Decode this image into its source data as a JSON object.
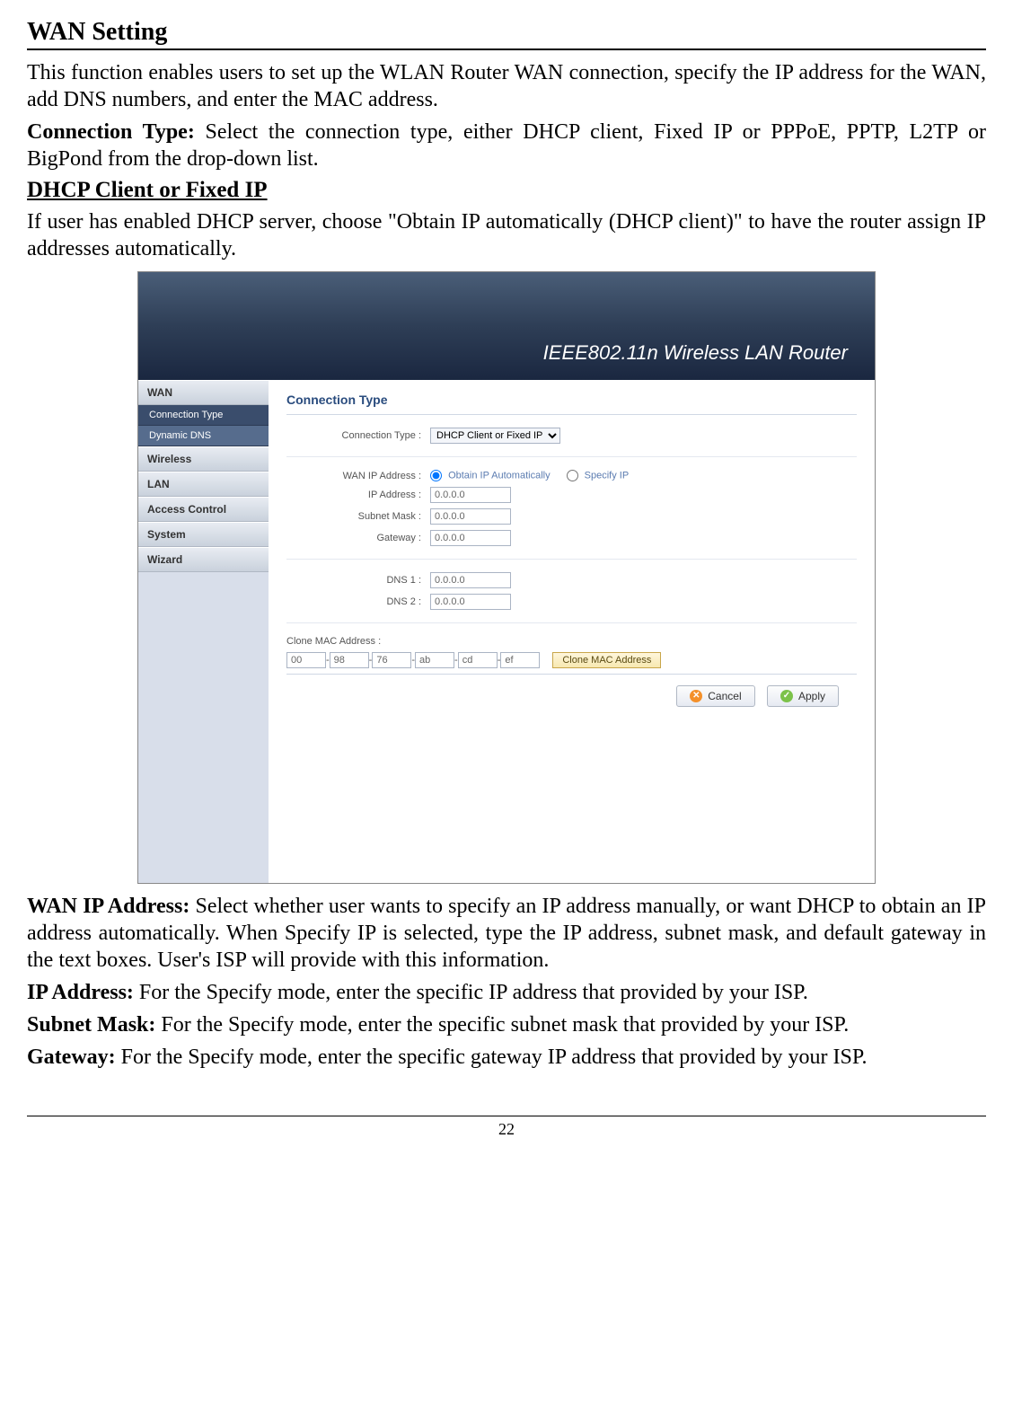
{
  "page": {
    "page_number": "22",
    "heading": "WAN Setting",
    "intro": "This function enables users to set up the WLAN Router WAN connection, specify the IP address for the WAN, add DNS numbers, and enter the MAC address.",
    "conn_type_label": "Connection Type:",
    "conn_type_text": " Select the connection type, either DHCP client, Fixed IP or PPPoE, PPTP, L2TP or BigPond from the drop-down list.",
    "sub_heading": "DHCP Client or Fixed IP",
    "dhcp_text": "If user has enabled DHCP server, choose \"Obtain IP automatically (DHCP client)\" to have the router assign IP addresses automatically.",
    "wan_ip_label": "WAN IP Address:",
    "wan_ip_text": " Select whether user wants to specify an IP address manually, or want DHCP to obtain an IP address automatically. When Specify IP is selected, type the IP address, subnet mask, and default gateway in the text boxes. User's ISP will provide with this information.",
    "ip_addr_label": "IP Address:",
    "ip_addr_text": " For the Specify mode, enter the specific IP address that provided by your ISP.",
    "subnet_label": "Subnet Mask:",
    "subnet_text": " For the Specify mode, enter the specific subnet mask that provided by your ISP.",
    "gateway_label": "Gateway:",
    "gateway_text": " For the Specify mode, enter the specific gateway IP address that provided by your ISP."
  },
  "ui": {
    "banner": "IEEE802.11n  Wireless LAN Router",
    "sidebar": {
      "wan": "WAN",
      "conn_type": "Connection Type",
      "dyn_dns": "Dynamic DNS",
      "wireless": "Wireless",
      "lan": "LAN",
      "access": "Access Control",
      "system": "System",
      "wizard": "Wizard"
    },
    "content": {
      "title": "Connection Type",
      "labels": {
        "conn_type": "Connection Type :",
        "wan_ip": "WAN IP Address :",
        "ip": "IP Address :",
        "subnet": "Subnet Mask :",
        "gateway": "Gateway :",
        "dns1": "DNS 1 :",
        "dns2": "DNS 2 :",
        "clone_mac": "Clone MAC Address :"
      },
      "dropdown_value": "DHCP Client or Fixed IP",
      "radio_obtain": "Obtain IP Automatically",
      "radio_specify": "Specify IP",
      "ip_value": "0.0.0.0",
      "subnet_value": "0.0.0.0",
      "gateway_value": "0.0.0.0",
      "dns1_value": "0.0.0.0",
      "dns2_value": "0.0.0.0",
      "mac": [
        "00",
        "98",
        "76",
        "ab",
        "cd",
        "ef"
      ],
      "clone_btn": "Clone MAC Address",
      "cancel": "Cancel",
      "apply": "Apply"
    }
  }
}
